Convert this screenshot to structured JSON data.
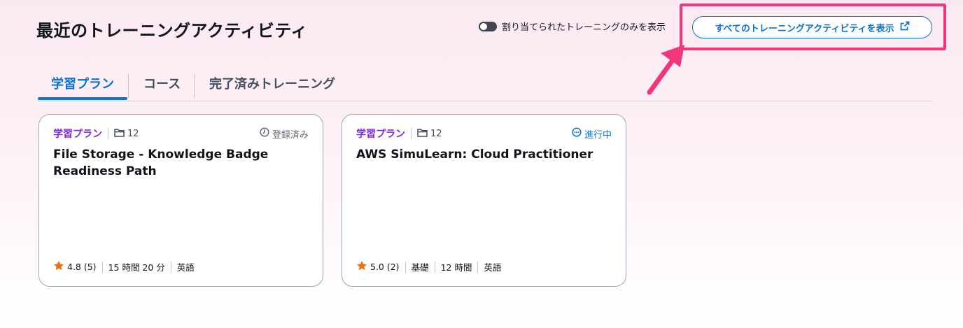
{
  "header": {
    "title": "最近のトレーニングアクティビティ",
    "toggle_label": "割り当てられたトレーニングのみを表示",
    "view_all_label": "すべてのトレーニングアクティビティを表示"
  },
  "tabs": [
    {
      "label": "学習プラン",
      "active": true
    },
    {
      "label": "コース",
      "active": false
    },
    {
      "label": "完了済みトレーニング",
      "active": false
    }
  ],
  "cards": [
    {
      "type": "学習プラン",
      "count": "12",
      "status": "登録済み",
      "title": "File Storage - Knowledge Badge Readiness Path",
      "rating": "4.8 (5)",
      "meta": [
        "15 時間 20 分",
        "英語"
      ]
    },
    {
      "type": "学習プラン",
      "count": "12",
      "status": "進行中",
      "title": "AWS SimuLearn: Cloud Practitioner",
      "rating": "5.0 (2)",
      "meta": [
        "基礎",
        "12 時間",
        "英語"
      ]
    }
  ],
  "colors": {
    "accent": "#0972d3",
    "highlight": "#f2357c",
    "learning_plan": "#7d2ddc",
    "star": "#ec7211"
  }
}
